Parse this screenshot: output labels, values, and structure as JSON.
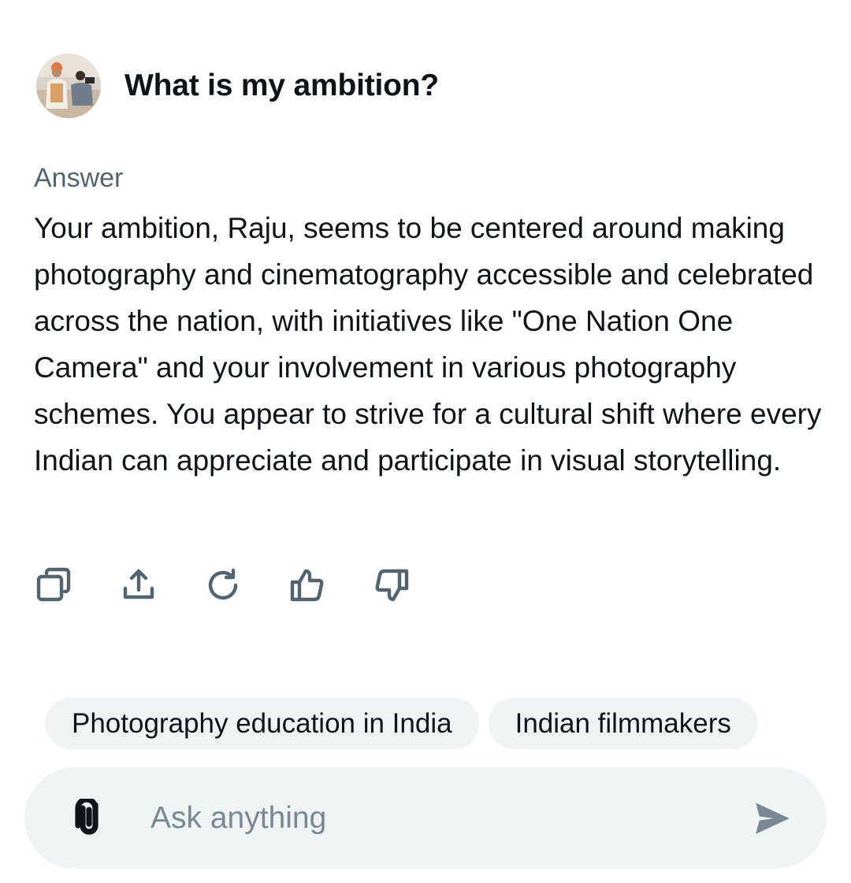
{
  "question": {
    "avatar_icon": "user-avatar-photo",
    "text": "What is my ambition?"
  },
  "answer": {
    "label": "Answer",
    "text": "Your ambition, Raju, seems to be centered around making photography and cinematography accessible and celebrated across the nation, with initiatives like \"One Nation One Camera\" and your involvement in various photography schemes. You appear to strive for a cultural shift where every Indian can appreciate and participate in visual storytelling."
  },
  "actions": [
    {
      "icon": "copy-icon"
    },
    {
      "icon": "share-icon"
    },
    {
      "icon": "regenerate-icon"
    },
    {
      "icon": "thumbs-up-icon"
    },
    {
      "icon": "thumbs-down-icon"
    }
  ],
  "suggestions": [
    "Photography education in India",
    "Indian filmmakers"
  ],
  "composer": {
    "attach_icon": "paperclip-icon",
    "placeholder": "Ask anything",
    "value": "",
    "send_icon": "send-icon"
  },
  "colors": {
    "text_primary": "#0f1419",
    "text_secondary": "#536471",
    "chip_background": "#eff3f4",
    "placeholder": "#7a8894"
  }
}
